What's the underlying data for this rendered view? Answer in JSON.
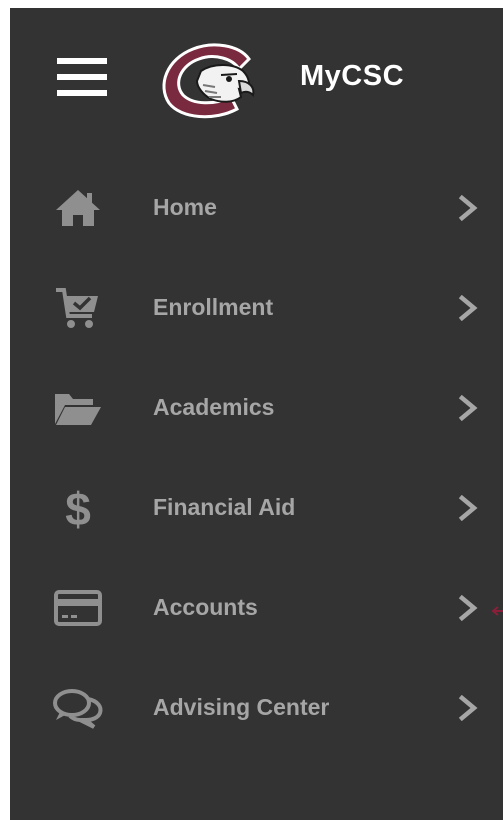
{
  "app": {
    "brand": "MyCSC"
  },
  "colors": {
    "background": "#333333",
    "label": "#a6a6a6",
    "icon": "#8f8f8f",
    "brand_text": "#ffffff",
    "logo_maroon": "#7a2a3e",
    "annotation_arrow": "#8a1f3a"
  },
  "header": {
    "menu_icon": "hamburger-icon",
    "logo_icon": "csc-eagle-logo"
  },
  "menu": {
    "items": [
      {
        "label": "Home",
        "icon": "house-icon"
      },
      {
        "label": "Enrollment",
        "icon": "cart-check-icon"
      },
      {
        "label": "Academics",
        "icon": "folder-open-icon"
      },
      {
        "label": "Financial Aid",
        "icon": "dollar-sign-icon"
      },
      {
        "label": "Accounts",
        "icon": "credit-card-icon"
      },
      {
        "label": "Advising Center",
        "icon": "chat-bubbles-icon"
      }
    ]
  }
}
